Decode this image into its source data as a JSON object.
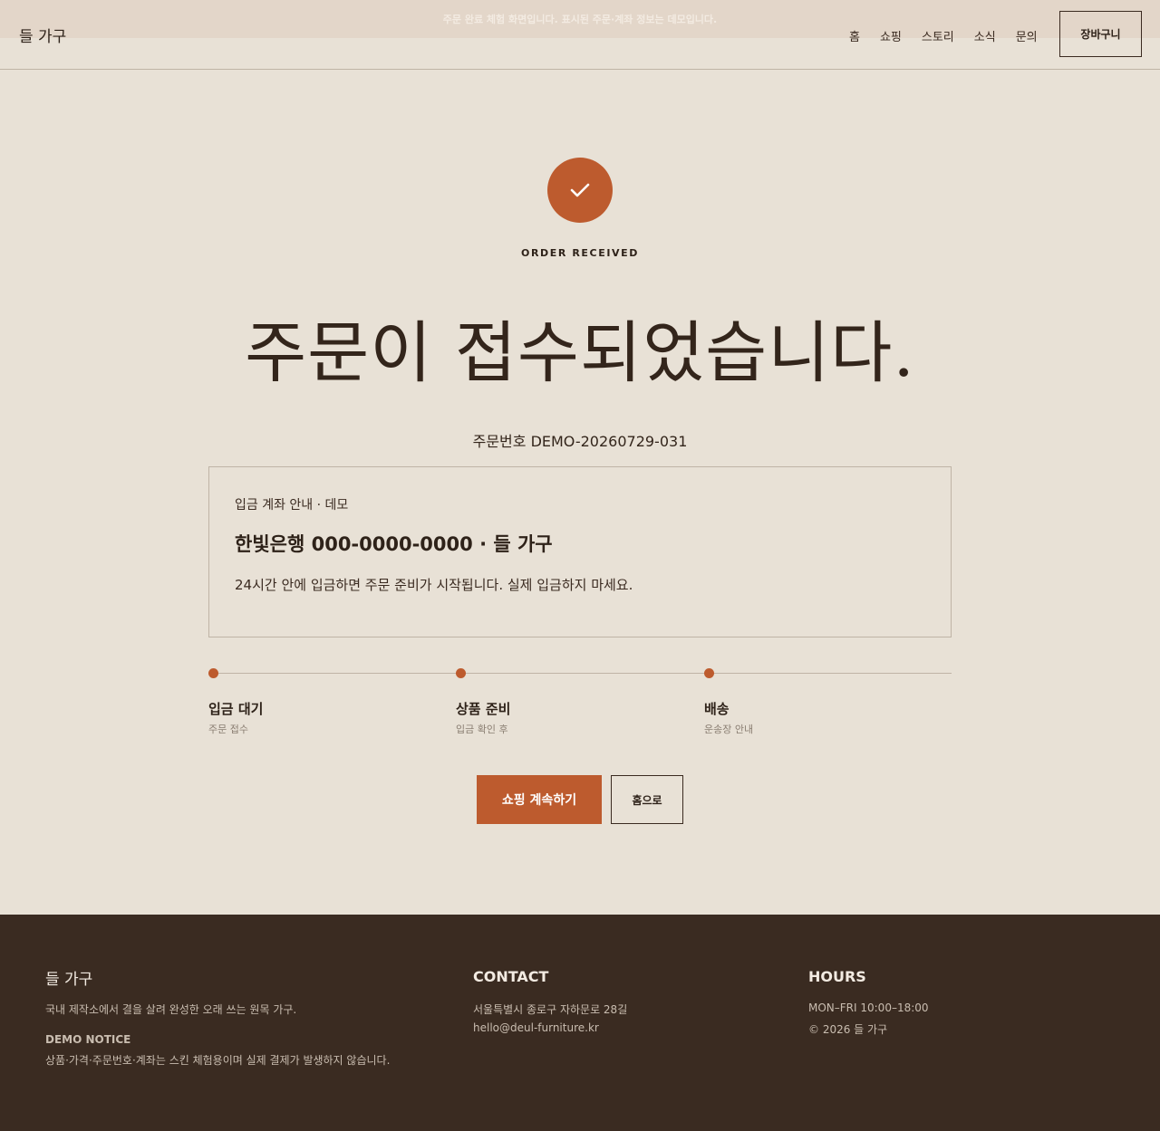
{
  "notice_strip": "주문 완료 체험 화면입니다. 표시된 주문·계좌 정보는 데모입니다.",
  "header": {
    "logo": "들 가구",
    "nav": [
      "홈",
      "쇼핑",
      "스토리",
      "소식",
      "문의"
    ],
    "cart_label": "장바구니"
  },
  "main": {
    "icon": "check-icon",
    "eyebrow": "ORDER RECEIVED",
    "headline": "주문이 접수되었습니다.",
    "order_number": "주문번호 DEMO-20260729-031",
    "account": {
      "label": "입금 계좌 안내 · 데모",
      "details": "한빛은행 000-0000-0000 · 들 가구",
      "description": "24시간 안에 입금하면 주문 준비가 시작됩니다. 실제 입금하지 마세요."
    },
    "steps": [
      {
        "title": "입금 대기",
        "subtitle": "주문 접수"
      },
      {
        "title": "상품 준비",
        "subtitle": "입금 확인 후"
      },
      {
        "title": "배송",
        "subtitle": "운송장 안내"
      }
    ],
    "buttons": {
      "continue_shopping": "쇼핑 계속하기",
      "home": "홈으로"
    }
  },
  "footer": {
    "logo": "들 가구",
    "tagline": "국내 제작소에서 결을 살려 완성한 오래 쓰는 원목 가구.",
    "demo_notice_title": "DEMO NOTICE",
    "demo_notice_text": "상품·가격·주문번호·계좌는 스킨 체험용이며 실제 결제가 발생하지 않습니다.",
    "contact_title": "CONTACT",
    "address": "서울특별시 종로구 자하문로 28길",
    "email": "hello@deul-furniture.kr",
    "hours_title": "HOURS",
    "hours": "MON–FRI 10:00–18:00",
    "copyright": "© 2026 들 가구"
  },
  "colors": {
    "background": "#e8e1d6",
    "accent": "#bd5b2e",
    "text": "#3a2a20",
    "footer_bg": "#3a2b21"
  }
}
